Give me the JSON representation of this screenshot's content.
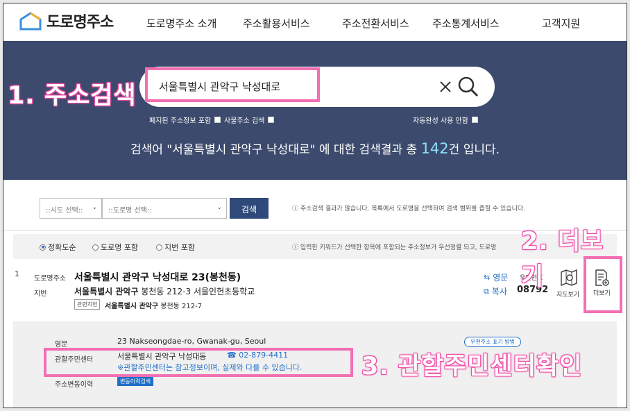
{
  "header": {
    "logo_text": "도로명주소",
    "nav": [
      "도로명주소 소개",
      "주소활용서비스",
      "주소전환서비스",
      "주소통계서비스",
      "고객지원"
    ]
  },
  "search": {
    "query": "서울특별시 관악구 낙성대로",
    "options": [
      "폐지된 주소정보 포함",
      "사물주소 검색",
      "자동완성 사용 안함"
    ],
    "result_prefix": "검색어 \"서울특별시 관악구 낙성대로\" 에 대한 검색결과 총",
    "result_count": "142",
    "result_suffix": "건 입니다."
  },
  "filter": {
    "sido_placeholder": "::시도 선택::",
    "road_placeholder": "::도로명 선택::",
    "search_button": "검색",
    "note": "ⓘ 주소검색 결과가 많습니다. 목록에서 도로명을 선택하여 검색 범위를 좁힐 수 있습니다."
  },
  "sort": {
    "options": [
      "정확도순",
      "도로명 포함",
      "지번 포함"
    ],
    "selected": 0,
    "note": "ⓘ 입력한 키워드가 선택한 항목에 포함되는 주소정보가 우선정렬 되고, 도로명"
  },
  "result": {
    "index": "1",
    "road_label": "도로명주소",
    "road_address": "서울특별시 관악구 낙성대로 23(봉천동)",
    "jibun_label": "지번",
    "jibun_bold": "서울특별시 관악구",
    "jibun_rest": "봉천동 212-3 서울인헌초등학교",
    "related_tag": "관련지번",
    "related_bold": "서울특별시 관악구",
    "related_rest": "봉천동 212-7",
    "english_btn": "영문",
    "copy_btn": "복사",
    "postal_label": "우편번호",
    "postal_code": "08792",
    "map_label": "지도보기",
    "more_label": "더보기"
  },
  "detail": {
    "english_label": "영문",
    "english_value": "23 Nakseongdae-ro, Gwanak-gu, Seoul",
    "center_label": "관할주민센터",
    "center_value": "서울특별시 관악구 낙성대동",
    "phone": "☎ 02-879-4411",
    "center_note": "※관할주민센터는 참고정보이며, 실제와 다를 수 있습니다.",
    "postal_pill": "우편주소 표기 방법",
    "history_label": "주소변동이력",
    "history_btn": "변동이력검색"
  },
  "annotations": {
    "step1": "1. 주소검색",
    "step2": "2. 더보기",
    "step3": "3. 관할주민센터확인"
  },
  "colors": {
    "band": "#3c4b6d",
    "accent": "#1f6fc7",
    "highlight": "#f26fb3"
  }
}
